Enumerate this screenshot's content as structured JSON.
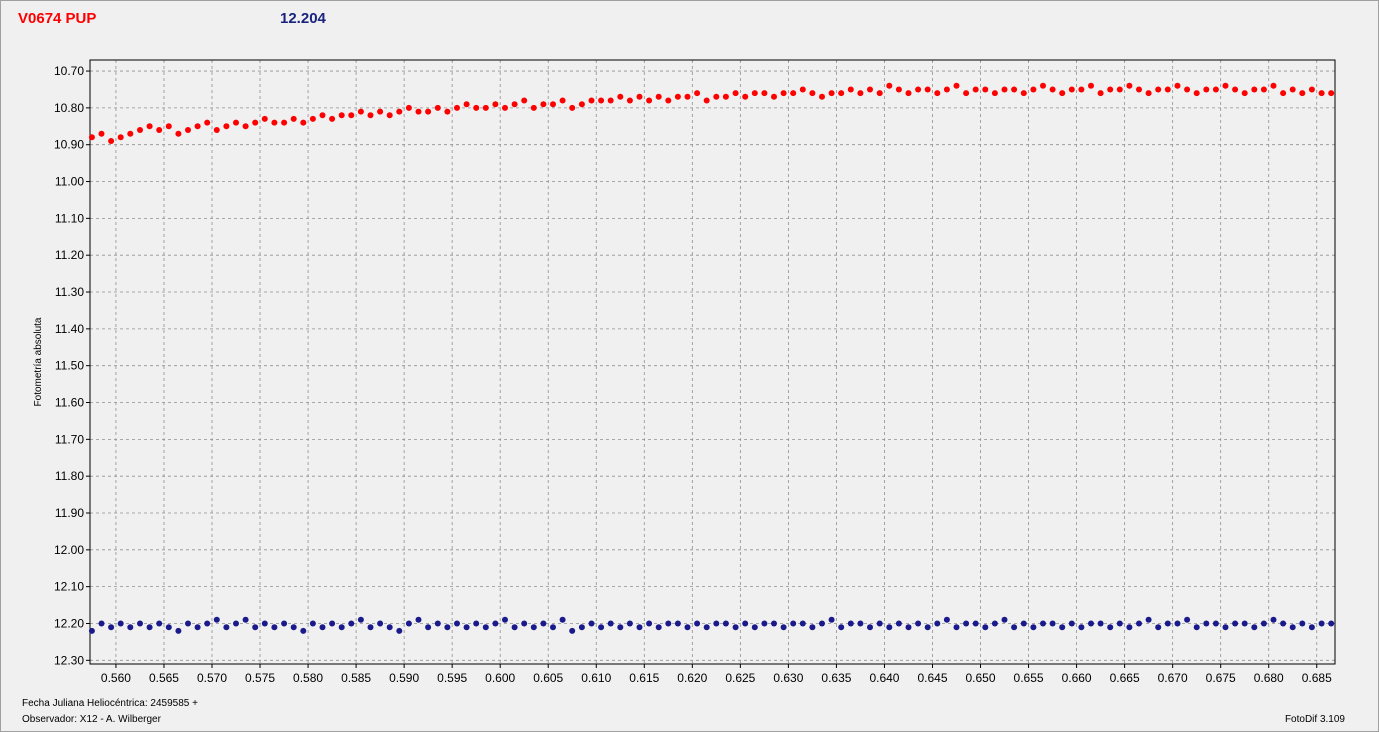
{
  "header": {
    "variable_star": "V0674 PUP",
    "comparison_value": "12.204"
  },
  "footer": {
    "jd_label": "Fecha Juliana Heliocéntrica: 2459585 +",
    "observer": "Observador: X12 - A. Wilberger",
    "software": "FotoDif 3.109"
  },
  "colors": {
    "variable": "#ff0000",
    "comparison": "#1a1a8c",
    "grid": "#909090",
    "plot_bg": "#f0f0f0"
  },
  "chart_data": {
    "type": "scatter",
    "title": "",
    "xlabel": "",
    "ylabel": "Fotometría absoluta",
    "xlim": [
      0.5573,
      0.6869
    ],
    "ylim": [
      10.67,
      12.31
    ],
    "y_inverted": true,
    "grid": true,
    "x_ticks": [
      "0.560",
      "0.565",
      "0.570",
      "0.575",
      "0.580",
      "0.585",
      "0.590",
      "0.595",
      "0.600",
      "0.605",
      "0.610",
      "0.615",
      "0.620",
      "0.625",
      "0.630",
      "0.635",
      "0.640",
      "0.645",
      "0.650",
      "0.655",
      "0.660",
      "0.665",
      "0.670",
      "0.675",
      "0.680",
      "0.685"
    ],
    "y_ticks": [
      "10.70",
      "10.80",
      "10.90",
      "11.00",
      "11.10",
      "11.20",
      "11.30",
      "11.40",
      "11.50",
      "11.60",
      "11.70",
      "11.80",
      "11.90",
      "12.00",
      "12.10",
      "12.20",
      "12.30"
    ],
    "series": [
      {
        "name": "V0674 PUP",
        "color": "#ff0000",
        "x": [
          0.5575,
          0.5585,
          0.5595,
          0.5605,
          0.5615,
          0.5625,
          0.5635,
          0.5645,
          0.5655,
          0.5665,
          0.5675,
          0.5685,
          0.5695,
          0.5705,
          0.5715,
          0.5725,
          0.5735,
          0.5745,
          0.5755,
          0.5765,
          0.5775,
          0.5785,
          0.5795,
          0.5805,
          0.5815,
          0.5825,
          0.5835,
          0.5845,
          0.5855,
          0.5865,
          0.5875,
          0.5885,
          0.5895,
          0.5905,
          0.5915,
          0.5925,
          0.5935,
          0.5945,
          0.5955,
          0.5965,
          0.5975,
          0.5985,
          0.5995,
          0.6005,
          0.6015,
          0.6025,
          0.6035,
          0.6045,
          0.6055,
          0.6065,
          0.6075,
          0.6085,
          0.6095,
          0.6105,
          0.6115,
          0.6125,
          0.6135,
          0.6145,
          0.6155,
          0.6165,
          0.6175,
          0.6185,
          0.6195,
          0.6205,
          0.6215,
          0.6225,
          0.6235,
          0.6245,
          0.6255,
          0.6265,
          0.6275,
          0.6285,
          0.6295,
          0.6305,
          0.6315,
          0.6325,
          0.6335,
          0.6345,
          0.6355,
          0.6365,
          0.6375,
          0.6385,
          0.6395,
          0.6405,
          0.6415,
          0.6425,
          0.6435,
          0.6445,
          0.6455,
          0.6465,
          0.6475,
          0.6485,
          0.6495,
          0.6505,
          0.6515,
          0.6525,
          0.6535,
          0.6545,
          0.6555,
          0.6565,
          0.6575,
          0.6585,
          0.6595,
          0.6605,
          0.6615,
          0.6625,
          0.6635,
          0.6645,
          0.6655,
          0.6665,
          0.6675,
          0.6685,
          0.6695,
          0.6705,
          0.6715,
          0.6725,
          0.6735,
          0.6745,
          0.6755,
          0.6765,
          0.6775,
          0.6785,
          0.6795,
          0.6805,
          0.6815,
          0.6825,
          0.6835,
          0.6845,
          0.6855,
          0.6865
        ],
        "y": [
          10.88,
          10.87,
          10.89,
          10.88,
          10.87,
          10.86,
          10.85,
          10.86,
          10.85,
          10.87,
          10.86,
          10.85,
          10.84,
          10.86,
          10.85,
          10.84,
          10.85,
          10.84,
          10.83,
          10.84,
          10.84,
          10.83,
          10.84,
          10.83,
          10.82,
          10.83,
          10.82,
          10.82,
          10.81,
          10.82,
          10.81,
          10.82,
          10.81,
          10.8,
          10.81,
          10.81,
          10.8,
          10.81,
          10.8,
          10.79,
          10.8,
          10.8,
          10.79,
          10.8,
          10.79,
          10.78,
          10.8,
          10.79,
          10.79,
          10.78,
          10.8,
          10.79,
          10.78,
          10.78,
          10.78,
          10.77,
          10.78,
          10.77,
          10.78,
          10.77,
          10.78,
          10.77,
          10.77,
          10.76,
          10.78,
          10.77,
          10.77,
          10.76,
          10.77,
          10.76,
          10.76,
          10.77,
          10.76,
          10.76,
          10.75,
          10.76,
          10.77,
          10.76,
          10.76,
          10.75,
          10.76,
          10.75,
          10.76,
          10.74,
          10.75,
          10.76,
          10.75,
          10.75,
          10.76,
          10.75,
          10.74,
          10.76,
          10.75,
          10.75,
          10.76,
          10.75,
          10.75,
          10.76,
          10.75,
          10.74,
          10.75,
          10.76,
          10.75,
          10.75,
          10.74,
          10.76,
          10.75,
          10.75,
          10.74,
          10.75,
          10.76,
          10.75,
          10.75,
          10.74,
          10.75,
          10.76,
          10.75,
          10.75,
          10.74,
          10.75,
          10.76,
          10.75,
          10.75,
          10.74,
          10.76,
          10.75,
          10.76,
          10.75,
          10.76,
          10.76
        ]
      },
      {
        "name": "12.204",
        "color": "#1a1a8c",
        "x": [
          0.5575,
          0.5585,
          0.5595,
          0.5605,
          0.5615,
          0.5625,
          0.5635,
          0.5645,
          0.5655,
          0.5665,
          0.5675,
          0.5685,
          0.5695,
          0.5705,
          0.5715,
          0.5725,
          0.5735,
          0.5745,
          0.5755,
          0.5765,
          0.5775,
          0.5785,
          0.5795,
          0.5805,
          0.5815,
          0.5825,
          0.5835,
          0.5845,
          0.5855,
          0.5865,
          0.5875,
          0.5885,
          0.5895,
          0.5905,
          0.5915,
          0.5925,
          0.5935,
          0.5945,
          0.5955,
          0.5965,
          0.5975,
          0.5985,
          0.5995,
          0.6005,
          0.6015,
          0.6025,
          0.6035,
          0.6045,
          0.6055,
          0.6065,
          0.6075,
          0.6085,
          0.6095,
          0.6105,
          0.6115,
          0.6125,
          0.6135,
          0.6145,
          0.6155,
          0.6165,
          0.6175,
          0.6185,
          0.6195,
          0.6205,
          0.6215,
          0.6225,
          0.6235,
          0.6245,
          0.6255,
          0.6265,
          0.6275,
          0.6285,
          0.6295,
          0.6305,
          0.6315,
          0.6325,
          0.6335,
          0.6345,
          0.6355,
          0.6365,
          0.6375,
          0.6385,
          0.6395,
          0.6405,
          0.6415,
          0.6425,
          0.6435,
          0.6445,
          0.6455,
          0.6465,
          0.6475,
          0.6485,
          0.6495,
          0.6505,
          0.6515,
          0.6525,
          0.6535,
          0.6545,
          0.6555,
          0.6565,
          0.6575,
          0.6585,
          0.6595,
          0.6605,
          0.6615,
          0.6625,
          0.6635,
          0.6645,
          0.6655,
          0.6665,
          0.6675,
          0.6685,
          0.6695,
          0.6705,
          0.6715,
          0.6725,
          0.6735,
          0.6745,
          0.6755,
          0.6765,
          0.6775,
          0.6785,
          0.6795,
          0.6805,
          0.6815,
          0.6825,
          0.6835,
          0.6845,
          0.6855,
          0.6865
        ],
        "y": [
          12.22,
          12.2,
          12.21,
          12.2,
          12.21,
          12.2,
          12.21,
          12.2,
          12.21,
          12.22,
          12.2,
          12.21,
          12.2,
          12.19,
          12.21,
          12.2,
          12.19,
          12.21,
          12.2,
          12.21,
          12.2,
          12.21,
          12.22,
          12.2,
          12.21,
          12.2,
          12.21,
          12.2,
          12.19,
          12.21,
          12.2,
          12.21,
          12.22,
          12.2,
          12.19,
          12.21,
          12.2,
          12.21,
          12.2,
          12.21,
          12.2,
          12.21,
          12.2,
          12.19,
          12.21,
          12.2,
          12.21,
          12.2,
          12.21,
          12.19,
          12.22,
          12.21,
          12.2,
          12.21,
          12.2,
          12.21,
          12.2,
          12.21,
          12.2,
          12.21,
          12.2,
          12.2,
          12.21,
          12.2,
          12.21,
          12.2,
          12.2,
          12.21,
          12.2,
          12.21,
          12.2,
          12.2,
          12.21,
          12.2,
          12.2,
          12.21,
          12.2,
          12.19,
          12.21,
          12.2,
          12.2,
          12.21,
          12.2,
          12.21,
          12.2,
          12.21,
          12.2,
          12.21,
          12.2,
          12.19,
          12.21,
          12.2,
          12.2,
          12.21,
          12.2,
          12.19,
          12.21,
          12.2,
          12.21,
          12.2,
          12.2,
          12.21,
          12.2,
          12.21,
          12.2,
          12.2,
          12.21,
          12.2,
          12.21,
          12.2,
          12.19,
          12.21,
          12.2,
          12.2,
          12.19,
          12.21,
          12.2,
          12.2,
          12.21,
          12.2,
          12.2,
          12.21,
          12.2,
          12.19,
          12.2,
          12.21,
          12.2,
          12.21,
          12.2,
          12.2
        ]
      }
    ]
  }
}
